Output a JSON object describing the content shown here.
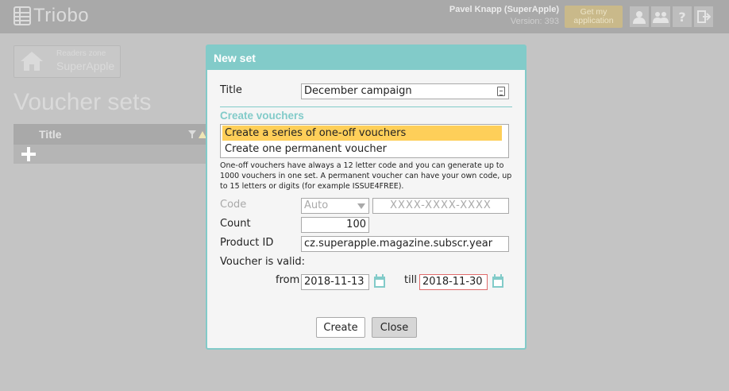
{
  "app": {
    "name": "Triobo",
    "user_name": "Pavel Knapp (SuperApple)",
    "version": "Version: 393",
    "get_app_button": "Get my application",
    "help_glyph": "?"
  },
  "breadcrumb": {
    "label": "Readers zone",
    "value": "SuperApple"
  },
  "page": {
    "title": "Voucher sets",
    "list_header_title": "Title"
  },
  "dialog": {
    "title": "New set",
    "title_label": "Title",
    "title_value": "December campaign",
    "section_title": "Create vouchers",
    "options": [
      "Create a series of one-off vouchers",
      "Create one permanent voucher"
    ],
    "selected_option": 0,
    "description": "One-off vouchers have always a 12 letter code and you can generate up to 1000 vouchers in one set. A permanent voucher can have your own code, up to 15 letters or digits (for example ISSUE4FREE).",
    "code_label": "Code",
    "code_mode": "Auto",
    "code_placeholder": "XXXX-XXXX-XXXX",
    "count_label": "Count",
    "count_value": "100",
    "product_label": "Product ID",
    "product_value": "cz.superapple.magazine.subscr.year",
    "valid_label": "Voucher is valid:",
    "from_label": "from",
    "from_value": "2018-11-13",
    "till_label": "till",
    "till_value": "2018-11-30",
    "create_button": "Create",
    "close_button": "Close"
  },
  "colors": {
    "accent": "#82cbc9",
    "selected_option": "#fecf59",
    "topbar": "#a9a9a9",
    "overlay_bg": "#c4c4c4"
  }
}
